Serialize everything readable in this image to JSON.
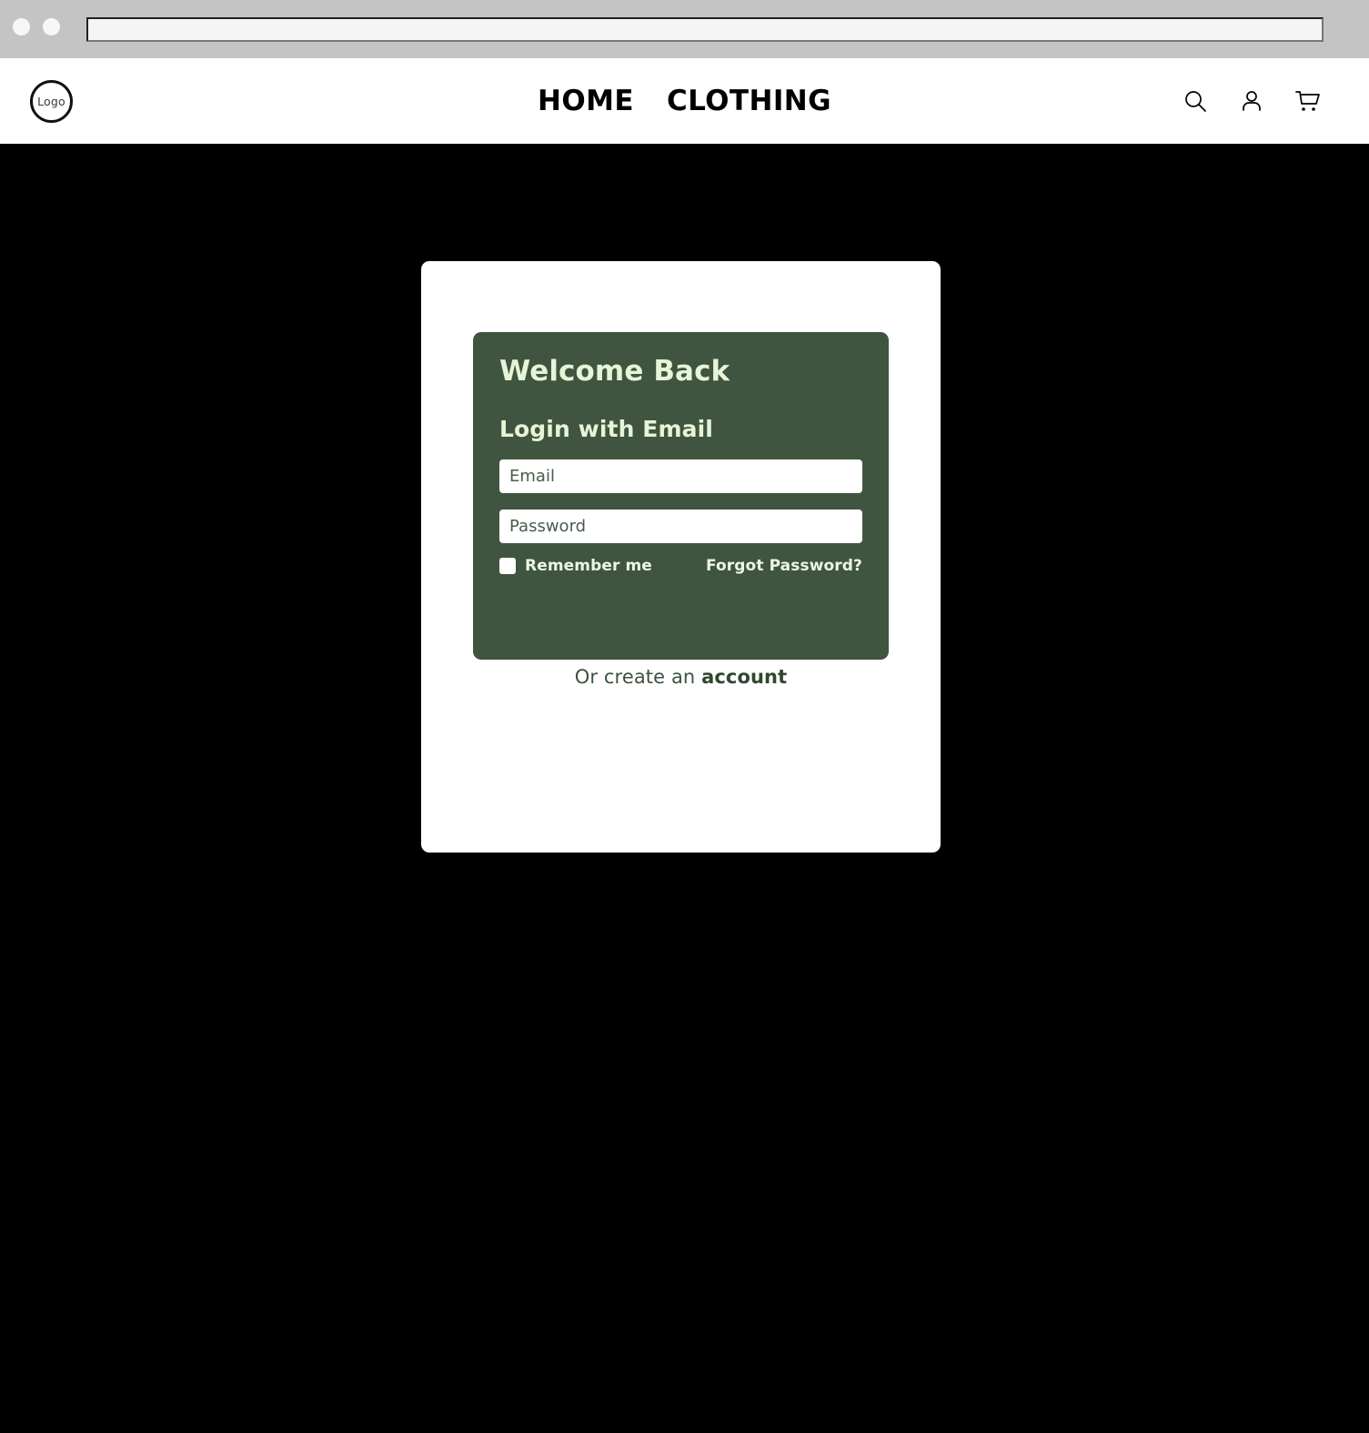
{
  "browser": {
    "dot_left": "window-dot",
    "dot_right": "window-dot",
    "address_value": "",
    "address_placeholder": ""
  },
  "header": {
    "logo_text": "Logo",
    "nav": [
      {
        "label": "HOME",
        "name": "nav-link-home"
      },
      {
        "label": "CLOTHING",
        "name": "nav-link-clothing"
      }
    ],
    "icons": [
      {
        "name": "search-icon",
        "label": "Search"
      },
      {
        "name": "account-icon",
        "label": "Account"
      },
      {
        "name": "cart-icon",
        "label": "Cart"
      }
    ]
  },
  "login_modal": {
    "title": "Welcome Back",
    "subtitle": "Login with Email",
    "email": {
      "value": "",
      "placeholder": "Email"
    },
    "password": {
      "value": "",
      "placeholder": "Password"
    },
    "remember_me_label": "Remember me",
    "remember_me_checked": false,
    "forgot_password_label": "Forgot Password?",
    "create_account_lead": "Or create an ",
    "create_account_link": "account"
  },
  "colors": {
    "panel_green": "#40553F",
    "panel_text": "#E6F4D7",
    "page_background": "#000000",
    "card_background": "#FFFFFF",
    "chrome_gray": "#C4C4C4",
    "link_green": "#31462F"
  }
}
